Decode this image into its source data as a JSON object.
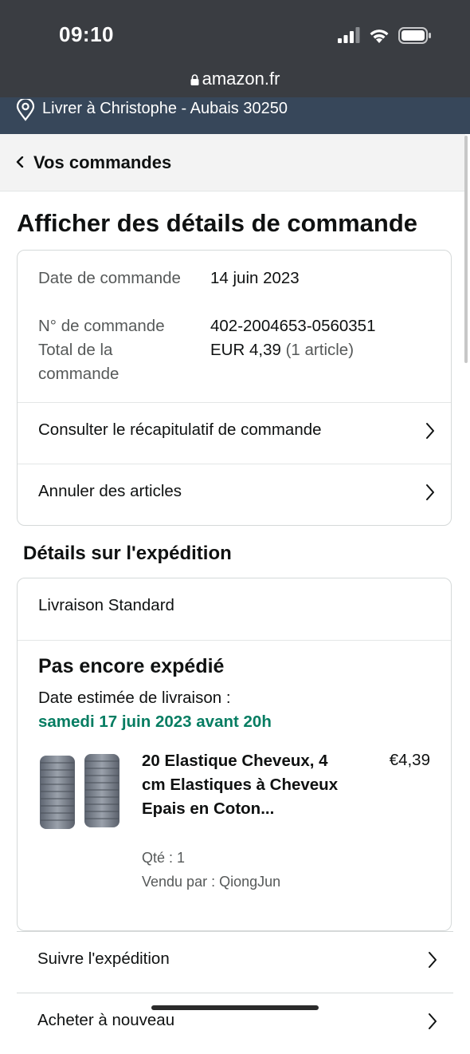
{
  "status_bar": {
    "time": "09:10",
    "icons": [
      "cellular-signal-icon",
      "wifi-icon",
      "battery-icon"
    ]
  },
  "url_bar": {
    "domain": "amazon.fr",
    "icon": "lock-icon"
  },
  "delivery": {
    "icon": "location-pin-icon",
    "text": "Livrer à Christophe - Aubais 30250"
  },
  "nav": {
    "back_label": "Vos commandes",
    "icon": "chevron-left-icon"
  },
  "page": {
    "title": "Afficher des détails de commande"
  },
  "order_info": {
    "date_label": "Date de commande",
    "date_value": "14 juin 2023",
    "number_label": "N° de commande",
    "number_value": "402-2004653-0560351",
    "total_label": "Total de la commande",
    "total_value": "EUR 4,39",
    "total_count": "(1 article)",
    "links": [
      {
        "label": "Consulter le récapitulatif de commande",
        "icon": "chevron-right-icon"
      },
      {
        "label": "Annuler des articles",
        "icon": "chevron-right-icon"
      }
    ]
  },
  "shipment": {
    "section_title": "Détails sur l'expédition",
    "method": "Livraison Standard",
    "status": "Pas encore expédié",
    "estimate_label": "Date estimée de livraison :",
    "estimate_date": "samedi 17 juin 2023 avant 20h",
    "product": {
      "title": "20 Elastique Cheveux, 4 cm Elastiques à Cheveux Epais en Coton...",
      "price": "€4,39",
      "qty": "Qté : 1",
      "seller": "Vendu par : QiongJun",
      "image_icon": "hair-elastics-product-image"
    }
  },
  "actions": [
    {
      "label": "Suivre l'expédition",
      "icon": "chevron-right-icon"
    },
    {
      "label": "Acheter à nouveau",
      "icon": "chevron-right-icon"
    }
  ],
  "colors": {
    "status_bar_bg": "#3a3d42",
    "delivery_bar_bg": "#37475a",
    "estimate_green": "#067d62",
    "nav_bg": "#f3f3f3"
  }
}
